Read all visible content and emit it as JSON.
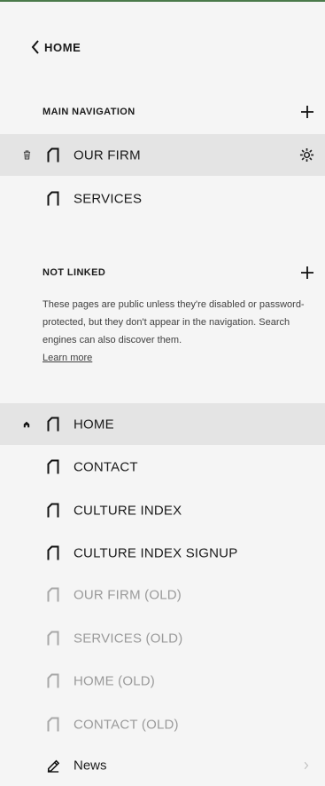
{
  "nav": {
    "back_label": "HOME"
  },
  "main_navigation": {
    "title": "MAIN NAVIGATION",
    "items": [
      {
        "label": "OUR FIRM",
        "selected": true
      },
      {
        "label": "SERVICES"
      }
    ]
  },
  "not_linked": {
    "title": "NOT LINKED",
    "description": "These pages are public unless they're disabled or password-protected, but they don't appear in the navigation. Search engines can also discover them.",
    "learn_more": "Learn more",
    "items": [
      {
        "label": "HOME",
        "selected": true,
        "homepage": true
      },
      {
        "label": "CONTACT"
      },
      {
        "label": "CULTURE INDEX"
      },
      {
        "label": "CULTURE INDEX SIGNUP"
      },
      {
        "label": "OUR FIRM (OLD)",
        "disabled": true
      },
      {
        "label": "SERVICES (OLD)",
        "disabled": true
      },
      {
        "label": "HOME (OLD)",
        "disabled": true
      },
      {
        "label": "CONTACT (OLD)",
        "disabled": true
      },
      {
        "label": "News",
        "type": "blog"
      }
    ]
  },
  "colors": {
    "selected_row": "#e4e4e4",
    "disabled_text": "#9a9a9a",
    "accent_line": "#4a7a4a"
  }
}
